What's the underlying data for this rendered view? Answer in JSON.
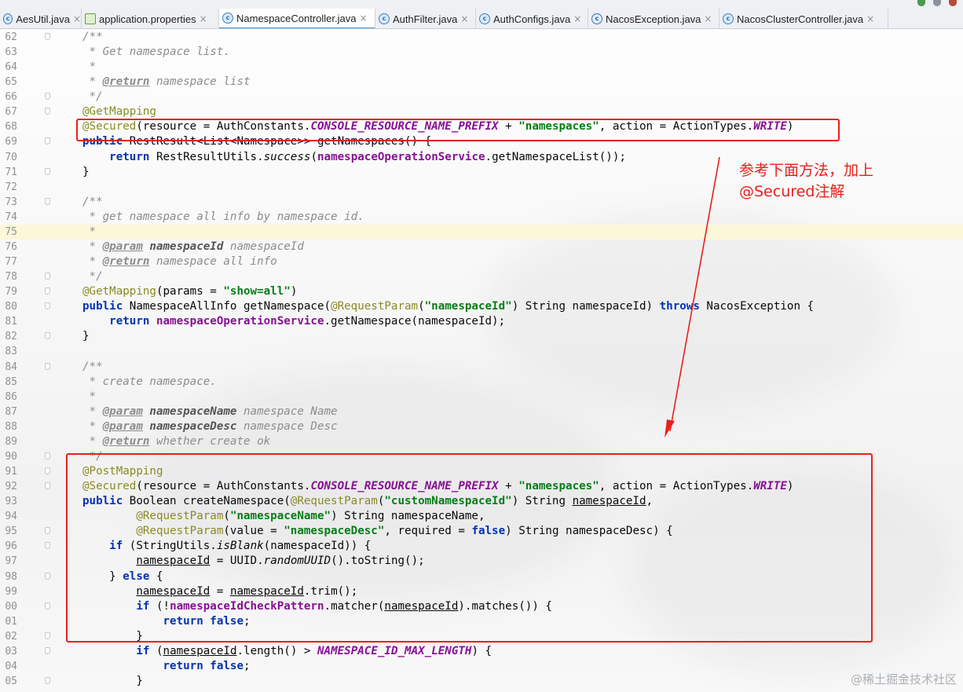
{
  "tabs": [
    {
      "label": "AesUtil.java",
      "icon": "class-file-icon",
      "active": false
    },
    {
      "label": "application.properties",
      "icon": "properties-file-icon",
      "active": false
    },
    {
      "label": "NamespaceController.java",
      "icon": "class-file-icon",
      "active": true
    },
    {
      "label": "AuthFilter.java",
      "icon": "class-file-icon",
      "active": false
    },
    {
      "label": "AuthConfigs.java",
      "icon": "class-file-icon",
      "active": false
    },
    {
      "label": "NacosException.java",
      "icon": "exception-file-icon",
      "active": false
    },
    {
      "label": "NacosClusterController.java",
      "icon": "class-file-icon",
      "active": false
    }
  ],
  "close_glyph": "×",
  "line_numbers": [
    "62",
    "63",
    "64",
    "65",
    "66",
    "67",
    "68",
    "69",
    "70",
    "71",
    "72",
    "73",
    "74",
    "75",
    "76",
    "77",
    "78",
    "79",
    "80",
    "81",
    "82",
    "83",
    "84",
    "85",
    "86",
    "87",
    "88",
    "89",
    "90",
    "91",
    "92",
    "93",
    "94",
    "95",
    "96",
    "97",
    "98",
    "99",
    "00",
    "01",
    "02",
    "03",
    "04",
    "05"
  ],
  "code_lines": [
    [
      [
        "/**",
        "cm"
      ]
    ],
    [
      [
        " * Get namespace list.",
        "cm"
      ]
    ],
    [
      [
        " *",
        "cm"
      ]
    ],
    [
      [
        " * ",
        "cm"
      ],
      [
        "@return",
        "tag"
      ],
      [
        " namespace list",
        "cm"
      ]
    ],
    [
      [
        " */",
        "cm"
      ]
    ],
    [
      [
        "@GetMapping",
        "ann"
      ]
    ],
    [
      [
        "@Secured",
        "ann"
      ],
      [
        "(resource = AuthConstants.",
        ""
      ],
      [
        "CONSOLE_RESOURCE_NAME_PREFIX",
        "cst"
      ],
      [
        " + ",
        ""
      ],
      [
        "\"namespaces\"",
        "str"
      ],
      [
        ", action = ActionTypes.",
        ""
      ],
      [
        "WRITE",
        "cst"
      ],
      [
        ")",
        ""
      ]
    ],
    [
      [
        "public",
        "kw"
      ],
      [
        " RestResult<List<Namespace>> getNamespaces() {",
        ""
      ]
    ],
    [
      [
        "    ",
        ""
      ],
      [
        "return",
        "kw"
      ],
      [
        " RestResultUtils.",
        ""
      ],
      [
        "success",
        "it"
      ],
      [
        "(",
        ""
      ],
      [
        "namespaceOperationService",
        "fld"
      ],
      [
        ".getNamespaceList());",
        ""
      ]
    ],
    [
      [
        "}",
        ""
      ]
    ],
    [
      [
        "",
        ""
      ]
    ],
    [
      [
        "/**",
        "cm"
      ]
    ],
    [
      [
        " * get namespace all info by namespace id.",
        "cm"
      ]
    ],
    [
      [
        " *",
        "cm"
      ]
    ],
    [
      [
        " * ",
        "cm"
      ],
      [
        "@param",
        "tag"
      ],
      [
        " ",
        "cm"
      ],
      [
        "namespaceId",
        "pname"
      ],
      [
        " namespaceId",
        "cm"
      ]
    ],
    [
      [
        " * ",
        "cm"
      ],
      [
        "@return",
        "tag"
      ],
      [
        " namespace all info",
        "cm"
      ]
    ],
    [
      [
        " */",
        "cm"
      ]
    ],
    [
      [
        "@GetMapping",
        "ann"
      ],
      [
        "(params = ",
        ""
      ],
      [
        "\"show=all\"",
        "str"
      ],
      [
        ")",
        ""
      ]
    ],
    [
      [
        "public",
        "kw"
      ],
      [
        " NamespaceAllInfo getNamespace(",
        ""
      ],
      [
        "@RequestParam",
        "ann"
      ],
      [
        "(",
        ""
      ],
      [
        "\"namespaceId\"",
        "str"
      ],
      [
        ") String namespaceId) ",
        ""
      ],
      [
        "throws",
        "kw"
      ],
      [
        " NacosException {",
        ""
      ]
    ],
    [
      [
        "    ",
        ""
      ],
      [
        "return",
        "kw"
      ],
      [
        " ",
        ""
      ],
      [
        "namespaceOperationService",
        "fld"
      ],
      [
        ".getNamespace(namespaceId);",
        ""
      ]
    ],
    [
      [
        "}",
        ""
      ]
    ],
    [
      [
        "",
        ""
      ]
    ],
    [
      [
        "/**",
        "cm"
      ]
    ],
    [
      [
        " * create namespace.",
        "cm"
      ]
    ],
    [
      [
        " *",
        "cm"
      ]
    ],
    [
      [
        " * ",
        "cm"
      ],
      [
        "@param",
        "tag"
      ],
      [
        " ",
        "cm"
      ],
      [
        "namespaceName",
        "pname"
      ],
      [
        " namespace Name",
        "cm"
      ]
    ],
    [
      [
        " * ",
        "cm"
      ],
      [
        "@param",
        "tag"
      ],
      [
        " ",
        "cm"
      ],
      [
        "namespaceDesc",
        "pname"
      ],
      [
        " namespace Desc",
        "cm"
      ]
    ],
    [
      [
        " * ",
        "cm"
      ],
      [
        "@return",
        "tag"
      ],
      [
        " whether create ok",
        "cm"
      ]
    ],
    [
      [
        " */",
        "cm"
      ]
    ],
    [
      [
        "@PostMapping",
        "ann"
      ]
    ],
    [
      [
        "@Secured",
        "ann"
      ],
      [
        "(resource = AuthConstants.",
        ""
      ],
      [
        "CONSOLE_RESOURCE_NAME_PREFIX",
        "cst"
      ],
      [
        " + ",
        ""
      ],
      [
        "\"namespaces\"",
        "str"
      ],
      [
        ", action = ActionTypes.",
        ""
      ],
      [
        "WRITE",
        "cst"
      ],
      [
        ")",
        ""
      ]
    ],
    [
      [
        "public",
        "kw"
      ],
      [
        " Boolean createNamespace(",
        ""
      ],
      [
        "@RequestParam",
        "ann"
      ],
      [
        "(",
        ""
      ],
      [
        "\"customNamespaceId\"",
        "str"
      ],
      [
        ") String ",
        ""
      ],
      [
        "namespaceId",
        "ul"
      ],
      [
        ",",
        ""
      ]
    ],
    [
      [
        "        ",
        ""
      ],
      [
        "@RequestParam",
        "ann"
      ],
      [
        "(",
        ""
      ],
      [
        "\"namespaceName\"",
        "str"
      ],
      [
        ") String namespaceName,",
        ""
      ]
    ],
    [
      [
        "        ",
        ""
      ],
      [
        "@RequestParam",
        "ann"
      ],
      [
        "(value = ",
        ""
      ],
      [
        "\"namespaceDesc\"",
        "str"
      ],
      [
        ", required = ",
        ""
      ],
      [
        "false",
        "kw"
      ],
      [
        ") String namespaceDesc) {",
        ""
      ]
    ],
    [
      [
        "    ",
        ""
      ],
      [
        "if",
        "kw"
      ],
      [
        " (StringUtils.",
        ""
      ],
      [
        "isBlank",
        "it"
      ],
      [
        "(namespaceId)) {",
        ""
      ]
    ],
    [
      [
        "        ",
        ""
      ],
      [
        "namespaceId",
        "ul"
      ],
      [
        " = UUID.",
        ""
      ],
      [
        "randomUUID",
        "it"
      ],
      [
        "().toString();",
        ""
      ]
    ],
    [
      [
        "    } ",
        ""
      ],
      [
        "else",
        "kw"
      ],
      [
        " {",
        ""
      ]
    ],
    [
      [
        "        ",
        ""
      ],
      [
        "namespaceId",
        "ul"
      ],
      [
        " = ",
        ""
      ],
      [
        "namespaceId",
        "ul"
      ],
      [
        ".trim();",
        ""
      ]
    ],
    [
      [
        "        ",
        ""
      ],
      [
        "if",
        "kw"
      ],
      [
        " (!",
        ""
      ],
      [
        "namespaceIdCheckPattern",
        "fld"
      ],
      [
        ".matcher(",
        ""
      ],
      [
        "namespaceId",
        "ul"
      ],
      [
        ").matches()) {",
        ""
      ]
    ],
    [
      [
        "            ",
        ""
      ],
      [
        "return false",
        "kw"
      ],
      [
        ";",
        ""
      ]
    ],
    [
      [
        "        }",
        ""
      ]
    ],
    [
      [
        "        ",
        ""
      ],
      [
        "if",
        "kw"
      ],
      [
        " (",
        ""
      ],
      [
        "namespaceId",
        "ul"
      ],
      [
        ".length() > ",
        ""
      ],
      [
        "NAMESPACE_ID_MAX_LENGTH",
        "cst"
      ],
      [
        ") {",
        ""
      ]
    ],
    [
      [
        "            ",
        ""
      ],
      [
        "return false",
        "kw"
      ],
      [
        ";",
        ""
      ]
    ],
    [
      [
        "        }",
        ""
      ]
    ]
  ],
  "current_line_index": 13,
  "annotation_note": "参考下面方法，加上\n@Secured注解",
  "watermark": "@稀土掘金技术社区",
  "accent_color": "#e8201a"
}
